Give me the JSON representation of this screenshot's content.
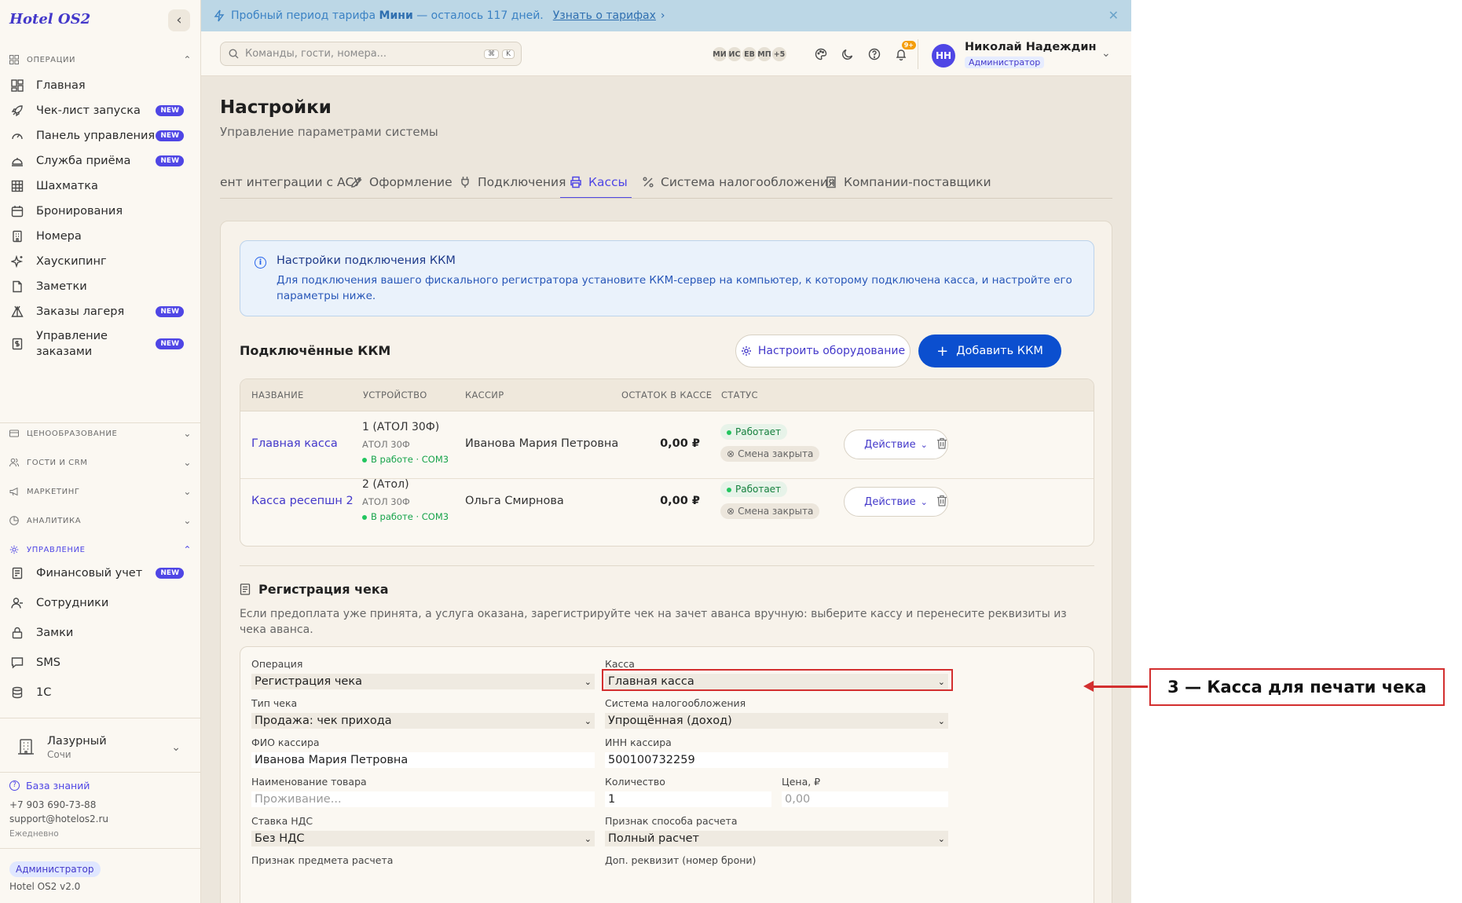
{
  "app": {
    "logo": "Hotel OS2",
    "collapse_icon": "‹"
  },
  "sidebar": {
    "sections": {
      "operations": "ОПЕРАЦИИ",
      "pricing": "ЦЕНООБРАЗОВАНИЕ",
      "guests": "ГОСТИ И CRM",
      "marketing": "МАРКЕТИНГ",
      "analytics": "АНАЛИТИКА",
      "management": "УПРАВЛЕНИЕ"
    },
    "ops_items": [
      {
        "label": "Главная",
        "new": false
      },
      {
        "label": "Чек-лист запуска",
        "new": true
      },
      {
        "label": "Панель управления",
        "new": true
      },
      {
        "label": "Служба приёма",
        "new": true
      },
      {
        "label": "Шахматка",
        "new": false
      },
      {
        "label": "Бронирования",
        "new": false
      },
      {
        "label": "Номера",
        "new": false
      },
      {
        "label": "Хаускипинг",
        "new": false
      },
      {
        "label": "Заметки",
        "new": false
      },
      {
        "label": "Заказы лагеря",
        "new": true
      },
      {
        "label": "Управление заказами",
        "new": true
      }
    ],
    "mgmt_items": [
      {
        "label": "Финансовый учет",
        "new": true
      },
      {
        "label": "Сотрудники",
        "new": false
      },
      {
        "label": "Замки",
        "new": false
      },
      {
        "label": "SMS",
        "new": false
      },
      {
        "label": "1С",
        "new": false
      }
    ],
    "badge_new": "NEW",
    "hotel": {
      "name": "Лазурный",
      "city": "Сочи"
    },
    "knowledge_base": "База знаний",
    "phone": "+7 903 690-73-88",
    "email": "support@hotelos2.ru",
    "schedule": "Ежедневно",
    "role": "Администратор",
    "version": "Hotel OS2 v2.0"
  },
  "banner": {
    "text_before": "Пробный период тарифа ",
    "plan": "Мини",
    "text_after": " — осталось 117 дней.",
    "link": "Узнать о тарифах",
    "link_chevron": "›",
    "close": "✕"
  },
  "header": {
    "search_placeholder": "Команды, гости, номера...",
    "kbd1": "⌘",
    "kbd2": "K",
    "avatars": [
      "МИ",
      "ИС",
      "ЕВ",
      "МП",
      "+5"
    ],
    "notif_count": "9+",
    "user_initials": "НН",
    "user_name": "Николай Надеждин",
    "user_role": "Администратор"
  },
  "page": {
    "title": "Настройки",
    "subtitle": "Управление параметрами системы",
    "tabs": [
      "ент интеграции с АСУ",
      "Оформление",
      "Подключения",
      "Кассы",
      "Система налогообложения",
      "Компании-поставщики"
    ],
    "active_tab": "Кассы"
  },
  "info": {
    "title": "Настройки подключения ККМ",
    "text": "Для подключения вашего фискального регистратора установите ККМ-сервер на компьютер, к которому подключена касса, и настройте его параметры ниже."
  },
  "kkm": {
    "title": "Подключённые ККМ",
    "configure_btn": "Настроить оборудование",
    "add_btn": "Добавить ККМ",
    "columns": [
      "НАЗВАНИЕ",
      "УСТРОЙСТВО",
      "КАССИР",
      "ОСТАТОК В КАССЕ",
      "СТАТУС"
    ],
    "rows": [
      {
        "name": "Главная касса",
        "device": "1 (АТОЛ 30Ф)",
        "model": "АТОЛ 30Ф",
        "device_status": "В работе · COM3",
        "cashier": "Иванова Мария Петровна",
        "balance": "0,00 ₽",
        "status": "Работает",
        "shift": "Смена закрыта",
        "action": "Действие"
      },
      {
        "name": "Касса ресепшн 2",
        "device": "2 (Атол)",
        "model": "АТОЛ 30Ф",
        "device_status": "В работе · COM3",
        "cashier": "Ольга Смирнова",
        "balance": "0,00 ₽",
        "status": "Работает",
        "shift": "Смена закрыта",
        "action": "Действие"
      }
    ]
  },
  "receipt": {
    "title": "Регистрация чека",
    "desc": "Если предоплата уже принята, а услуга оказана, зарегистрируйте чек на зачет аванса вручную: выберите кассу и перенесите реквизиты из чека аванса.",
    "fields": {
      "operation_label": "Операция",
      "operation_value": "Регистрация чека",
      "register_label": "Касса",
      "register_value": "Главная касса",
      "type_label": "Тип чека",
      "type_value": "Продажа: чек прихода",
      "tax_label": "Система налогообложения",
      "tax_value": "Упрощённая (доход)",
      "cashier_label": "ФИО кассира",
      "cashier_value": "Иванова Мария Петровна",
      "inn_label": "ИНН кассира",
      "inn_value": "500100732259",
      "goods_label": "Наименование товара",
      "goods_placeholder": "Проживание...",
      "qty_label": "Количество",
      "qty_value": "1",
      "price_label": "Цена, ₽",
      "price_placeholder": "0,00",
      "vat_label": "Ставка НДС",
      "vat_value": "Без НДС",
      "method_label": "Признак способа расчета",
      "method_value": "Полный расчет",
      "subject_label": "Признак предмета расчета",
      "extra_label": "Доп. реквизит (номер брони)"
    }
  },
  "annotation": {
    "text": "3 — Касса для печати чека"
  },
  "colors": {
    "accent": "#4f46e5",
    "primary_button": "#0b4fcf",
    "highlight": "#d32f2f",
    "success": "#16a34a"
  }
}
